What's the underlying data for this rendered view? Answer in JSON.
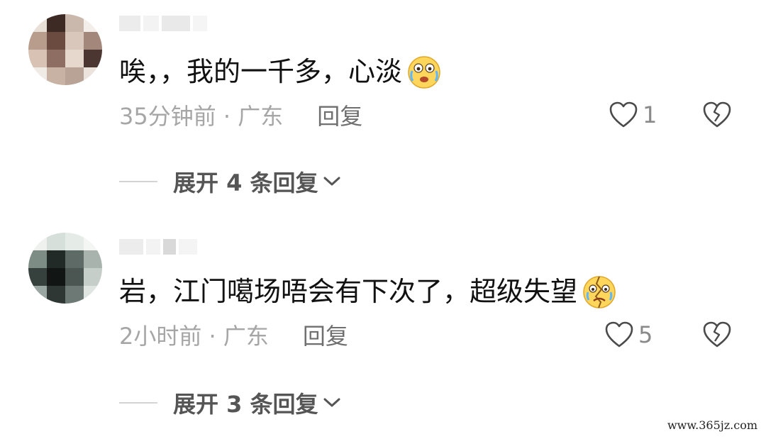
{
  "comments": [
    {
      "text": "唉，，我的一千多，心淡",
      "emoji": "crying-laughing-emoji",
      "time_location": "35分钟前 · 广东",
      "reply_label": "回复",
      "like_count": "1",
      "expand_label": "展开 4 条回复"
    },
    {
      "text": "岩，江门噶场唔会有下次了，超级失望",
      "emoji": "broken-face-emoji",
      "time_location": "2小时前 · 广东",
      "reply_label": "回复",
      "like_count": "5",
      "expand_label": "展开 3 条回复"
    }
  ],
  "icons": {
    "like": "heart-outline-icon",
    "dislike": "broken-heart-icon",
    "expand": "chevron-down-icon"
  },
  "colors": {
    "text": "#111111",
    "muted": "#a6a6a6",
    "reply": "#6f6f6f",
    "icon": "#4a4a4a"
  },
  "watermark": "www.365jz.com"
}
